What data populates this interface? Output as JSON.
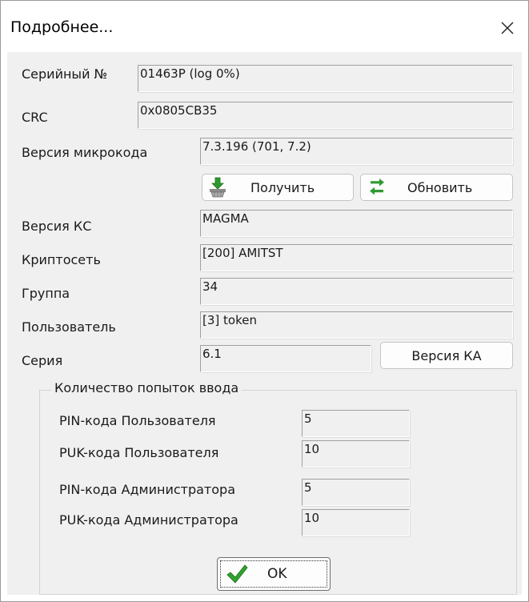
{
  "window": {
    "title": "Подробнее...",
    "close_glyph": "✕"
  },
  "fields": {
    "serial_label": "Серийный №",
    "serial_value": "01463P (log 0%)",
    "crc_label": "CRC",
    "crc_value": "0x0805CB35",
    "firmware_label": "Версия микрокода",
    "firmware_value": "7.3.196 (701, 7.2)",
    "ks_label": "Версия КС",
    "ks_value": "MAGMA",
    "cryptonet_label": "Криптосеть",
    "cryptonet_value": "[200] AMITST",
    "group_label": "Группа",
    "group_value": "34",
    "user_label": "Пользователь",
    "user_value": "[3] token",
    "series_label": "Серия",
    "series_value": "6.1"
  },
  "buttons": {
    "get_label": "Получить",
    "get_icon": "download-basket-icon",
    "refresh_label": "Обновить",
    "refresh_icon": "refresh-arrows-icon",
    "ka_version_label": "Версия КА",
    "ok_label": "OK",
    "ok_icon": "checkmark-icon"
  },
  "attempts": {
    "title": "Количество попыток ввода",
    "user_pin_label": "PIN-кода Пользователя",
    "user_pin_value": "5",
    "user_puk_label": "PUK-кода Пользователя",
    "user_puk_value": "10",
    "admin_pin_label": "PIN-кода Администратора",
    "admin_pin_value": "5",
    "admin_puk_label": "PUK-кода Администратора",
    "admin_puk_value": "10"
  },
  "colors": {
    "client_bg": "#f0f0f0",
    "refresh_green": "#2e9a2e",
    "check_green": "#2fa32f"
  }
}
